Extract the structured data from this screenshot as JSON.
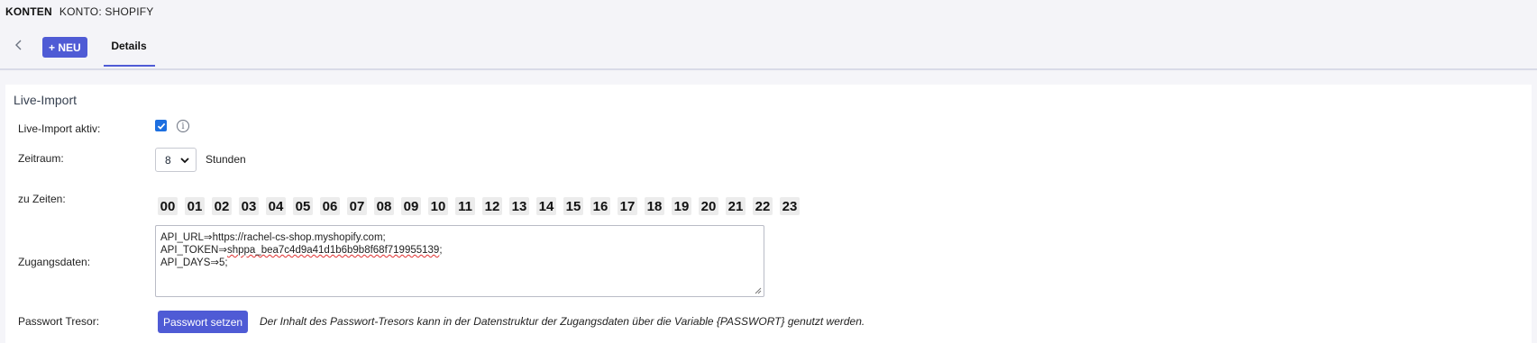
{
  "breadcrumb": {
    "main": "KONTEN",
    "sub": "KONTO: SHOPIFY"
  },
  "toolbar": {
    "new_label": "+ NEU",
    "tab_details": "Details"
  },
  "section": {
    "title": "Live-Import",
    "live_import_label": "Live-Import aktiv:",
    "live_import_checked": true,
    "info_icon": "i",
    "period_label": "Zeitraum:",
    "period_value": "8",
    "period_unit": "Stunden",
    "times_label": "zu Zeiten:",
    "hours": [
      "00",
      "01",
      "02",
      "03",
      "04",
      "05",
      "06",
      "07",
      "08",
      "09",
      "10",
      "11",
      "12",
      "13",
      "14",
      "15",
      "16",
      "17",
      "18",
      "19",
      "20",
      "21",
      "22",
      "23"
    ],
    "credentials_label": "Zugangsdaten:",
    "credentials": {
      "line1": "API_URL⇒https://rachel-cs-shop.myshopify.com;",
      "line2_prefix": "API_TOKEN⇒",
      "line2_token": "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",
      "line2_suffix": ";",
      "line3": "API_DAYS⇒5;"
    },
    "password_label": "Passwort Tresor:",
    "password_button": "Passwort setzen",
    "password_note": "Der Inhalt des Passwort-Tresors kann in der Datenstruktur der Zugangsdaten über die Variable {PASSWORT} genutzt werden."
  },
  "colors": {
    "accent": "#4f5bd5",
    "checkbox": "#1d6fe0"
  }
}
